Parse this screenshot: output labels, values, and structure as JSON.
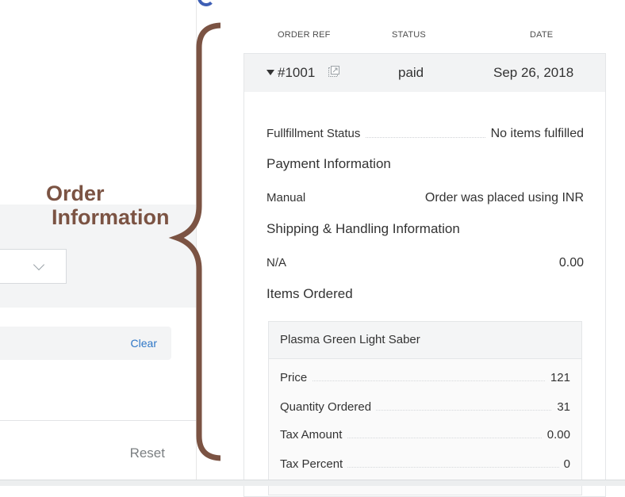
{
  "left": {
    "clear_label": "Clear",
    "reset_label": "Reset"
  },
  "annotation": {
    "line1": "Order",
    "line2": "Information",
    "color": "#7b5343"
  },
  "table": {
    "columns": [
      "ORDER REF",
      "STATUS",
      "DATE"
    ]
  },
  "order": {
    "ref": "#1001",
    "status": "paid",
    "date": "Sep 26, 2018",
    "fulfillment": {
      "label": "Fullfillment Status",
      "value": "No items fulfilled"
    },
    "payment_section": "Payment Information",
    "payment": {
      "label": "Manual",
      "value": "Order was placed using INR"
    },
    "shipping_section": "Shipping & Handling Information",
    "shipping": {
      "label": "N/A",
      "value": "0.00"
    },
    "items_section": "Items Ordered",
    "item": {
      "name": "Plasma Green Light Saber",
      "rows": [
        {
          "label": "Price",
          "value": "121"
        },
        {
          "label": "Quantity Ordered",
          "value": "31"
        },
        {
          "label": "Tax Amount",
          "value": "0.00"
        },
        {
          "label": "Tax Percent",
          "value": "0"
        }
      ]
    }
  },
  "icons": {
    "expand": "caret-down-icon",
    "open": "external-link-icon",
    "select": "chevron-down-icon"
  },
  "colors": {
    "link": "#2d76c6",
    "accent_circle": "#3e5fb5"
  }
}
